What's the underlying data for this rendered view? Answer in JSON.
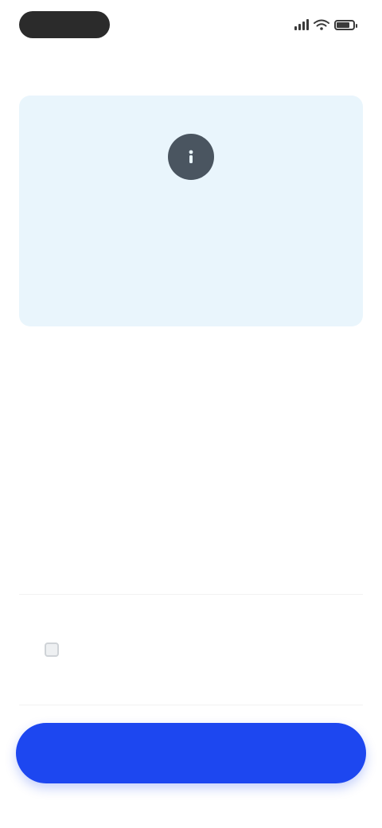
{
  "status_bar": {
    "time": "",
    "icons": [
      "signal-icon",
      "wifi-icon",
      "battery-icon"
    ],
    "battery_level": 0.8
  },
  "header": {
    "title": ""
  },
  "card": {
    "icon": "info-icon",
    "heading": "",
    "body": ""
  },
  "option": {
    "label": ""
  },
  "footer": {
    "primary_label": ""
  },
  "colors": {
    "accent": "#1d47f0",
    "card_background": "#e9f5fc",
    "card_icon": "#4a5560"
  }
}
